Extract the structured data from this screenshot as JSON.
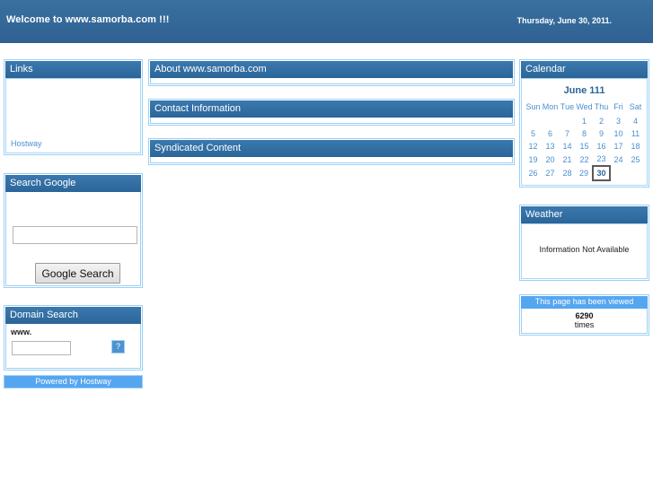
{
  "banner": {
    "title": "Welcome to www.samorba.com !!!",
    "date": "Thursday, June 30, 2011.",
    "bg_color": "#336699"
  },
  "left_column": {
    "links_panel": {
      "title": "Links",
      "items": [
        {
          "label": "Hostway"
        }
      ]
    },
    "google_search_panel": {
      "title": "Search Google",
      "input_value": "",
      "input_placeholder": "",
      "button_label": "Google Search"
    },
    "domain_search_panel": {
      "title": "Domain Search",
      "prefix_label": "www.",
      "input_value": "",
      "input_placeholder": "",
      "go_icon": "broken-image-icon",
      "go_glyph": "?"
    },
    "powered_by": "Powered by Hostway"
  },
  "center_column": {
    "panels": [
      {
        "title": "About www.samorba.com",
        "body": ""
      },
      {
        "title": "Contact Information",
        "body": ""
      },
      {
        "title": "Syndicated Content",
        "body": ""
      }
    ]
  },
  "right_column": {
    "calendar_panel": {
      "title": "Calendar",
      "month_title": "June 111",
      "weekdays": [
        "Sun",
        "Mon",
        "Tue",
        "Wed",
        "Thu",
        "Fri",
        "Sat"
      ],
      "weeks": [
        [
          "",
          "",
          "",
          "1",
          "2",
          "3",
          "4"
        ],
        [
          "5",
          "6",
          "7",
          "8",
          "9",
          "10",
          "11"
        ],
        [
          "12",
          "13",
          "14",
          "15",
          "16",
          "17",
          "18"
        ],
        [
          "19",
          "20",
          "21",
          "22",
          "23",
          "24",
          "25"
        ],
        [
          "26",
          "27",
          "28",
          "29",
          "30",
          "",
          ""
        ]
      ],
      "today": "30",
      "link_color": "#4a8fd0"
    },
    "weather_panel": {
      "title": "Weather",
      "message": "Information Not Available"
    },
    "counter_panel": {
      "title": "This page has been viewed",
      "count": "6290",
      "unit_label": "times",
      "header_color": "#55a6f0"
    }
  },
  "theme": {
    "panel_header": "#2e6da4",
    "panel_border": "#9dd0f5",
    "accent_light": "#55a6f0",
    "link": "#4a8fd0",
    "background": "#ffffff"
  }
}
